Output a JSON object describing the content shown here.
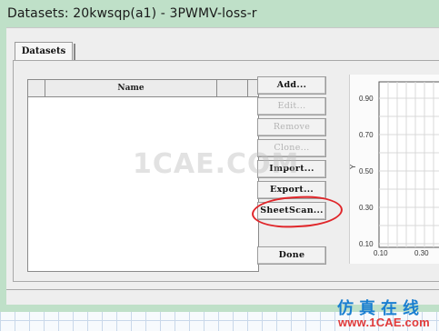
{
  "window": {
    "title": "Datasets: 20kwsqp(a1) - 3PWMV-loss-r"
  },
  "tabs": [
    {
      "label": "Datasets",
      "selected": true
    }
  ],
  "list": {
    "columns": [
      "",
      "Name",
      ""
    ]
  },
  "buttons": {
    "add": {
      "label": "Add...",
      "enabled": true
    },
    "edit": {
      "label": "Edit...",
      "enabled": false
    },
    "remove": {
      "label": "Remove",
      "enabled": false
    },
    "clone": {
      "label": "Clone...",
      "enabled": false
    },
    "import": {
      "label": "Import...",
      "enabled": true
    },
    "export": {
      "label": "Export...",
      "enabled": true
    },
    "sheetscan": {
      "label": "SheetScan...",
      "enabled": true
    },
    "done": {
      "label": "Done",
      "enabled": true
    }
  },
  "plot": {
    "ylabel": "Y",
    "y_ticks": [
      "0.90",
      "0.70",
      "0.50",
      "0.30",
      "0.10"
    ],
    "x_ticks": [
      "0.10",
      "0.30"
    ]
  },
  "watermark": "1CAE.COM",
  "branding": {
    "chinese": "仿真在线",
    "url": "www.1CAE.com"
  },
  "colors": {
    "titlebar": "#bfe0c8",
    "highlight": "#e0262a",
    "brand_blue": "#1a7fd0",
    "brand_red": "#e03a3a"
  }
}
